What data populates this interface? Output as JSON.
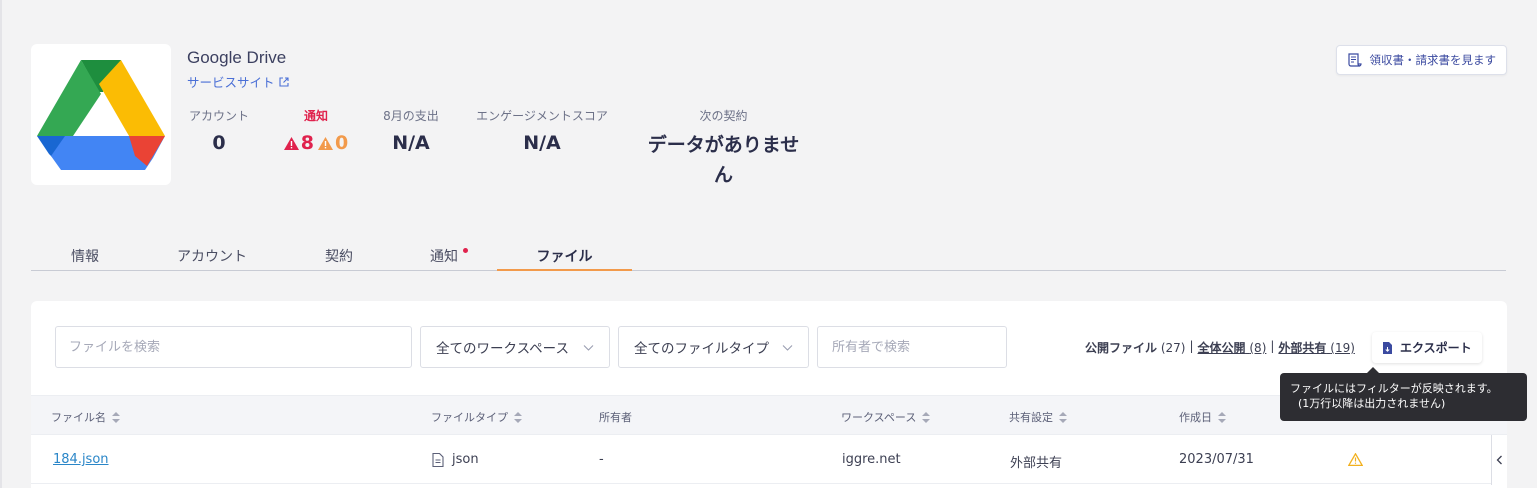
{
  "app": {
    "title": "Google Drive",
    "service_link": "サービスサイト",
    "logo": "google-drive-logo"
  },
  "stats": {
    "accounts": {
      "label": "アカウント",
      "value": "0"
    },
    "alerts": {
      "label": "通知",
      "critical": "8",
      "warning": "0"
    },
    "spend": {
      "label": "8月の支出",
      "value": "N/A"
    },
    "engagement": {
      "label": "エンゲージメントスコア",
      "value": "N/A"
    },
    "next_contract": {
      "label": "次の契約",
      "value": "データがありません"
    }
  },
  "receipt_button": "領収書・請求書を見ます",
  "tabs": [
    {
      "label": "情報",
      "active": false
    },
    {
      "label": "アカウント",
      "active": false
    },
    {
      "label": "契約",
      "active": false
    },
    {
      "label": "通知",
      "active": false,
      "dot": true
    },
    {
      "label": "ファイル",
      "active": true
    }
  ],
  "filters": {
    "search_placeholder": "ファイルを検索",
    "workspace_select": "全てのワークスペース",
    "filetype_select": "全てのファイルタイプ",
    "owner_placeholder": "所有者で検索"
  },
  "share_summary": {
    "public_label": "公開ファイル",
    "public_count": "(27)",
    "sep": "|",
    "all_public_label": "全体公開",
    "all_public_count": "(8)",
    "external_label": "外部共有",
    "external_count": "(19)"
  },
  "export_button": "エクスポート",
  "tooltip": {
    "line1": "ファイルにはフィルターが反映されます。",
    "line2": "(1万行以降は出力されません)"
  },
  "table": {
    "columns": [
      "ファイル名",
      "ファイルタイプ",
      "所有者",
      "ワークスペース",
      "共有設定",
      "作成日"
    ],
    "rows": [
      {
        "name": "184.json",
        "type": "json",
        "owner": "-",
        "workspace": "iggre.net",
        "sharing": "外部共有",
        "created": "2023/07/31",
        "status": "warning"
      }
    ]
  },
  "colors": {
    "accent": "#f29a4b",
    "alert_red": "#e0224d",
    "link": "#2a86c8",
    "primary_text": "#2b2e4a"
  }
}
